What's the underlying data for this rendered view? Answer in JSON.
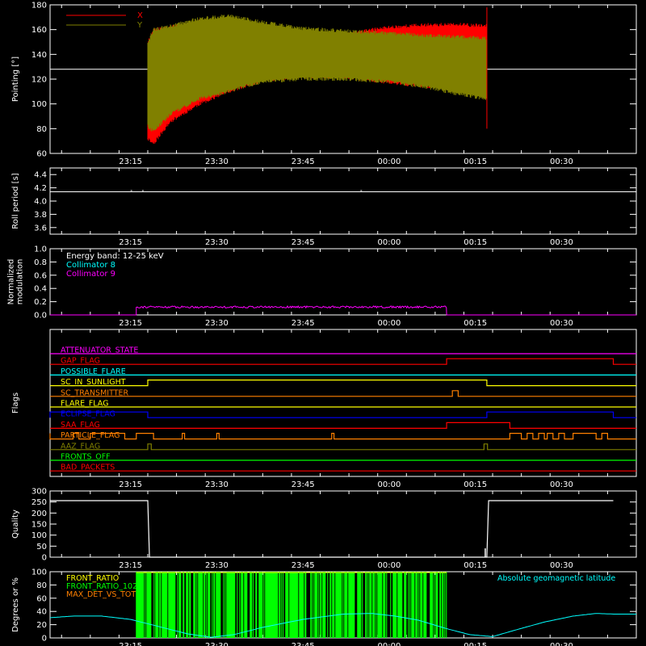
{
  "chart_data": [
    {
      "type": "line",
      "panel": "pointing",
      "ylabel": "Pointing [°]",
      "ylim": [
        60,
        180
      ],
      "yticks": [
        60,
        80,
        100,
        120,
        140,
        160,
        180
      ],
      "xlim_minutes": [
        1381,
        1483
      ],
      "xticks": [
        "23:15",
        "23:30",
        "23:45",
        "00:00",
        "00:15",
        "00:30"
      ],
      "reference_line": 128,
      "series": [
        {
          "name": "X",
          "color": "#ff0000",
          "x": [
            "23:18",
            "23:19",
            "23:22",
            "23:27",
            "23:32",
            "23:38",
            "23:45",
            "23:52",
            "00:00",
            "00:07",
            "00:12",
            "00:17"
          ],
          "upper": [
            150,
            160,
            162,
            167,
            168,
            162,
            155,
            156,
            162,
            164,
            164,
            163
          ],
          "lower": [
            72,
            68,
            86,
            100,
            110,
            119,
            122,
            122,
            117,
            114,
            115,
            115
          ]
        },
        {
          "name": "Y",
          "color": "#808000",
          "x": [
            "23:18",
            "23:19",
            "23:22",
            "23:27",
            "23:32",
            "23:38",
            "23:45",
            "23:52",
            "00:00",
            "00:07",
            "00:12",
            "00:17"
          ],
          "upper": [
            150,
            160,
            163,
            169,
            171,
            166,
            161,
            159,
            157,
            155,
            154,
            153
          ],
          "lower": [
            82,
            78,
            92,
            104,
            110,
            118,
            120,
            120,
            118,
            113,
            108,
            104
          ]
        }
      ]
    },
    {
      "type": "line",
      "panel": "roll-period",
      "ylabel": "Roll period [s]",
      "ylim": [
        3.5,
        4.5
      ],
      "yticks": [
        3.6,
        3.8,
        4.0,
        4.2,
        4.4
      ],
      "xticks": [
        "23:15",
        "23:30",
        "23:45",
        "00:00",
        "00:15",
        "00:30"
      ],
      "series": [
        {
          "name": "",
          "color": "#ffffff",
          "constant": 4.14
        }
      ]
    },
    {
      "type": "line",
      "panel": "modulation",
      "ylabel": "Normalized\nmodulation",
      "ylim": [
        0,
        1.0
      ],
      "yticks": [
        0.0,
        0.2,
        0.4,
        0.6,
        0.8,
        1.0
      ],
      "xticks": [
        "23:15",
        "23:30",
        "23:45",
        "00:00",
        "00:15",
        "00:30"
      ],
      "legend": [
        "Energy band: 12-25 keV",
        "Collimator 8",
        "Collimator 9"
      ],
      "legend_colors": [
        "#ffffff",
        "#00ffff",
        "#ff00ff"
      ],
      "series": [
        {
          "name": "Collimator 9",
          "color": "#ff00ff",
          "start": "23:16",
          "end": "00:10",
          "mean": 0.12,
          "noise": 0.015
        }
      ]
    },
    {
      "type": "line",
      "panel": "flags",
      "ylabel": "Flags",
      "xticks": [
        "23:15",
        "23:30",
        "23:45",
        "00:00",
        "00:15",
        "00:30"
      ],
      "flags": [
        {
          "name": "ATTENUATOR_STATE",
          "color": "#ff00ff",
          "high_intervals": []
        },
        {
          "name": "GAP_FLAG",
          "color": "#ff0000",
          "high_intervals": [
            [
              "00:10",
              "00:39"
            ]
          ]
        },
        {
          "name": "POSSIBLE_FLARE",
          "color": "#00ffff",
          "high_intervals": []
        },
        {
          "name": "SC_IN_SUNLIGHT",
          "color": "#ffff00",
          "high_intervals": [
            [
              "23:18",
              "00:17"
            ]
          ]
        },
        {
          "name": "SC_TRANSMITTER",
          "color": "#ff8000",
          "high_intervals": [
            [
              "00:11",
              "00:12"
            ]
          ]
        },
        {
          "name": "FLARE_FLAG",
          "color": "#ffff00",
          "high_intervals": []
        },
        {
          "name": "ECLIPSE_FLAG",
          "color": "#0000ff",
          "high_intervals": [
            [
              "23:00",
              "23:18"
            ],
            [
              "00:17",
              "00:39"
            ]
          ]
        },
        {
          "name": "SAA_FLAG",
          "color": "#ff0000",
          "high_intervals": [
            [
              "00:10",
              "00:21"
            ]
          ]
        },
        {
          "name": "PARTICLE_FLAG",
          "color": "#ff8000",
          "high_intervals": [
            [
              "23:00",
              "23:01"
            ],
            [
              "23:05",
              "23:06"
            ],
            [
              "23:08",
              "23:14"
            ],
            [
              "23:16",
              "23:19"
            ],
            [
              "23:24",
              "23:24.4"
            ],
            [
              "23:30",
              "23:30.4"
            ],
            [
              "23:50",
              "23:50.4"
            ],
            [
              "00:21",
              "00:23"
            ],
            [
              "00:24",
              "00:25"
            ],
            [
              "00:26",
              "00:27"
            ],
            [
              "00:27.5",
              "00:28.5"
            ],
            [
              "00:29.5",
              "00:30.5"
            ],
            [
              "00:32",
              "00:36"
            ],
            [
              "00:37",
              "00:38"
            ]
          ]
        },
        {
          "name": "AAZ_FLAG",
          "color": "#808000",
          "high_intervals": [
            [
              "23:18",
              "23:18.6"
            ],
            [
              "00:16.5",
              "00:17.1"
            ]
          ]
        },
        {
          "name": "FRONTS_OFF",
          "color": "#00ff00",
          "high_intervals": []
        },
        {
          "name": "BAD_PACKETS",
          "color": "#ff0000",
          "high_intervals": []
        }
      ]
    },
    {
      "type": "line",
      "panel": "quality",
      "ylabel": "Quality",
      "ylim": [
        0,
        300
      ],
      "yticks": [
        0,
        50,
        100,
        150,
        200,
        250,
        300
      ],
      "xticks": [
        "23:15",
        "23:30",
        "23:45",
        "00:00",
        "00:15",
        "00:30"
      ],
      "series": [
        {
          "name": "",
          "color": "#ffffff",
          "x": [
            "23:00",
            "23:18",
            "23:18.3",
            "00:17",
            "00:17.3",
            "00:39"
          ],
          "values": [
            256,
            256,
            0,
            0,
            256,
            256
          ]
        }
      ]
    },
    {
      "type": "line",
      "panel": "front-ratio",
      "ylabel": "Degrees or %",
      "ylim": [
        0,
        100
      ],
      "yticks": [
        0,
        20,
        40,
        60,
        80,
        100
      ],
      "xticks": [
        "23:15",
        "23:30",
        "23:45",
        "00:00",
        "00:15",
        "00:30"
      ],
      "legend": [
        "FRONT_RATIO",
        "FRONT_RATIO_1024",
        "MAX_DET_VS_TOT"
      ],
      "legend_colors": [
        "#ffff00",
        "#00ff00",
        "#ff8000"
      ],
      "annotation": "Absolute geomagnetic latitude",
      "annotation_color": "#00ffff",
      "series": [
        {
          "name": "Absolute geomagnetic latitude",
          "color": "#00ffff",
          "x": [
            "23:00",
            "23:05",
            "23:10",
            "23:15",
            "23:20",
            "23:25",
            "23:29",
            "23:33",
            "23:38",
            "23:45",
            "23:52",
            "23:57",
            "00:01",
            "00:05",
            "00:10",
            "00:14",
            "00:18",
            "00:22",
            "00:27",
            "00:32",
            "00:36",
            "00:39"
          ],
          "values": [
            30,
            33,
            33,
            28,
            17,
            6,
            1,
            5,
            16,
            28,
            36,
            37,
            33,
            27,
            14,
            5,
            2,
            12,
            24,
            33,
            37,
            36
          ]
        },
        {
          "name": "FRONT_RATIO_1024",
          "color": "#00ff00",
          "start": "23:16",
          "end": "00:10"
        }
      ]
    }
  ]
}
